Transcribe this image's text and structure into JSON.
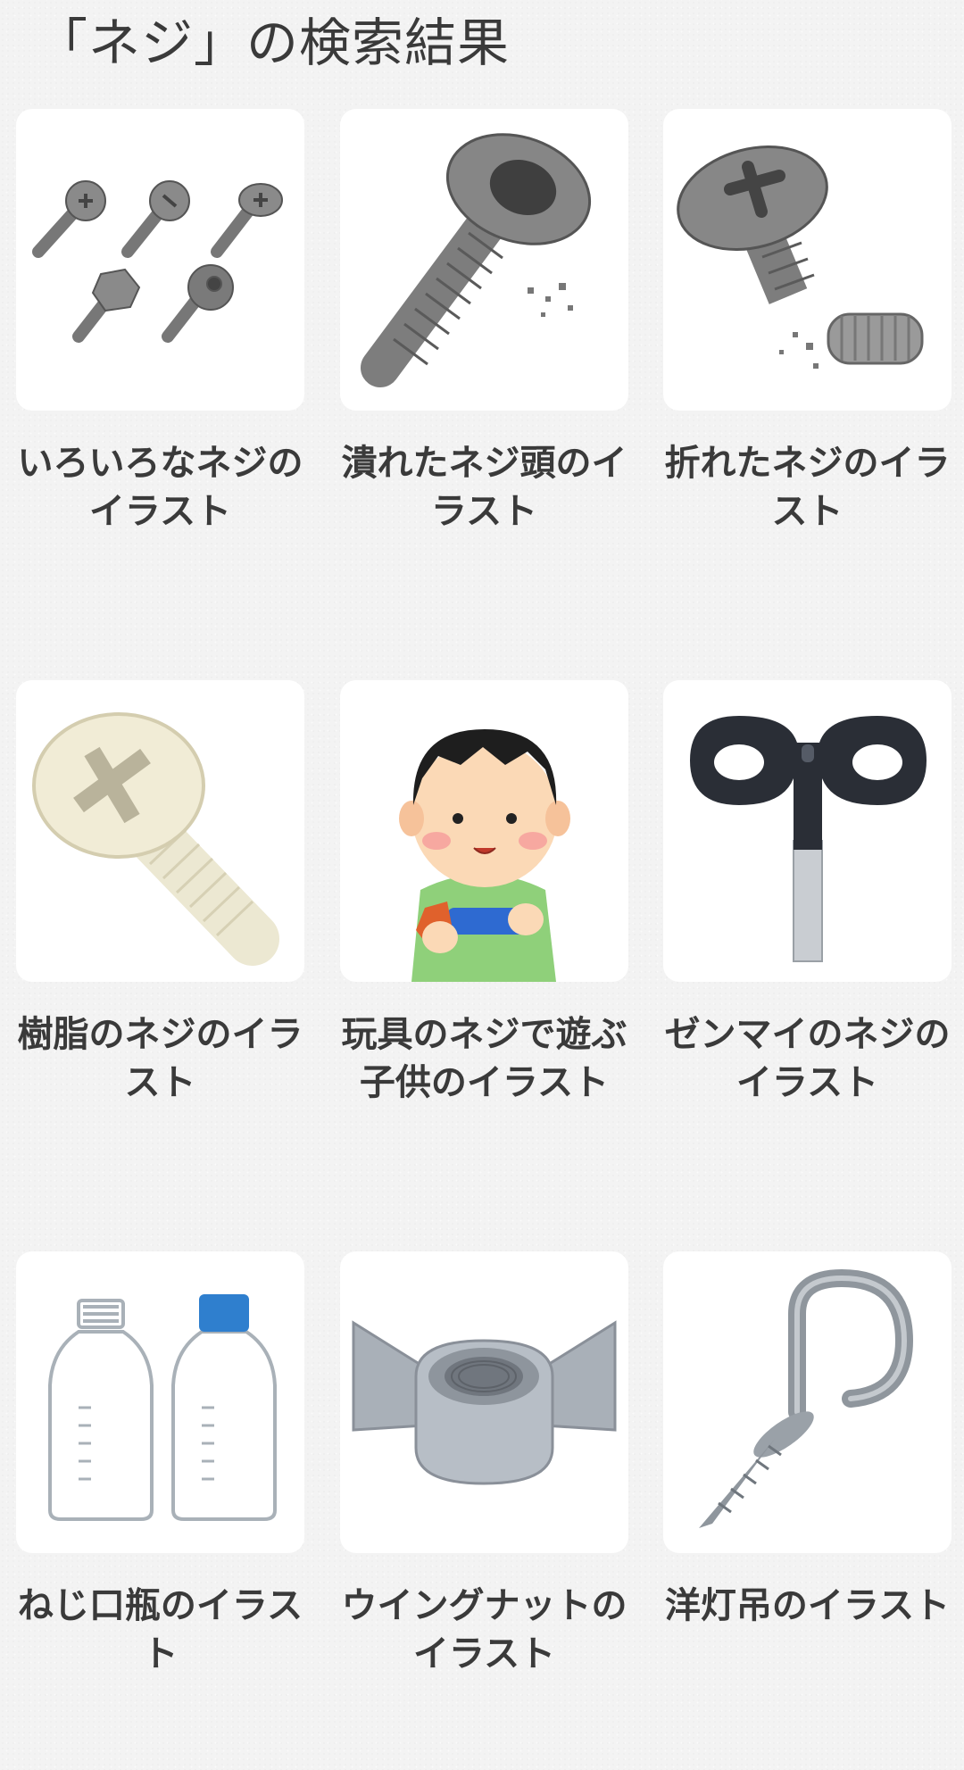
{
  "header": {
    "title": "「ネジ」の検索結果"
  },
  "results": [
    {
      "caption": "いろいろなネジのイラスト",
      "icon": "assorted-screws-icon"
    },
    {
      "caption": "潰れたネジ頭のイラスト",
      "icon": "stripped-screw-head-icon"
    },
    {
      "caption": "折れたネジのイラスト",
      "icon": "broken-screw-icon"
    },
    {
      "caption": "樹脂のネジのイラスト",
      "icon": "plastic-screw-icon"
    },
    {
      "caption": "玩具のネジで遊ぶ子供のイラスト",
      "icon": "child-playing-toy-screw-icon"
    },
    {
      "caption": "ゼンマイのネジのイラスト",
      "icon": "wind-up-key-icon"
    },
    {
      "caption": "ねじ口瓶のイラスト",
      "icon": "screw-cap-bottles-icon"
    },
    {
      "caption": "ウイングナットのイラスト",
      "icon": "wing-nut-icon"
    },
    {
      "caption": "洋灯吊のイラスト",
      "icon": "screw-hook-icon"
    }
  ],
  "colors": {
    "background": "#f3f3f3",
    "card": "#ffffff",
    "text": "#3a3a3a",
    "metal": "#8a8a8a",
    "metal_dark": "#5f5f5f"
  }
}
